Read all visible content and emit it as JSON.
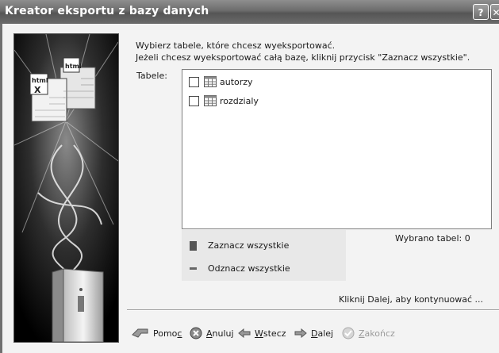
{
  "window": {
    "title": "Kreator eksportu z bazy danych",
    "help_glyph": "?",
    "close_glyph": "✕"
  },
  "instructions": {
    "line1": "Wybierz tabele, które chcesz wyeksportować.",
    "line2": "Jeżeli chcesz wyeksportować całą bazę, kliknij przycisk \"Zaznacz wszystkie\"."
  },
  "tables": {
    "label": "Tabele:",
    "items": [
      {
        "label": "autorzy",
        "checked": false
      },
      {
        "label": "rozdzialy",
        "checked": false
      }
    ]
  },
  "actions": {
    "select_all": "Zaznacz wszystkie",
    "deselect_all": "Odznacz wszystkie"
  },
  "selection_count": "Wybrano tabel: 0",
  "hint": "Kliknij Dalej, aby kontynuować ...",
  "illustration": {
    "doc_label_top": "html",
    "doc_label_bottom": "X"
  },
  "buttons": {
    "help": {
      "pre": "Pomo",
      "key": "c",
      "post": ""
    },
    "cancel": {
      "pre": "",
      "key": "A",
      "post": "nuluj"
    },
    "back": {
      "pre": "",
      "key": "W",
      "post": "stecz"
    },
    "next": {
      "pre": "",
      "key": "D",
      "post": "alej"
    },
    "finish": {
      "pre": "",
      "key": "Z",
      "post": "akończ",
      "enabled": false
    }
  }
}
